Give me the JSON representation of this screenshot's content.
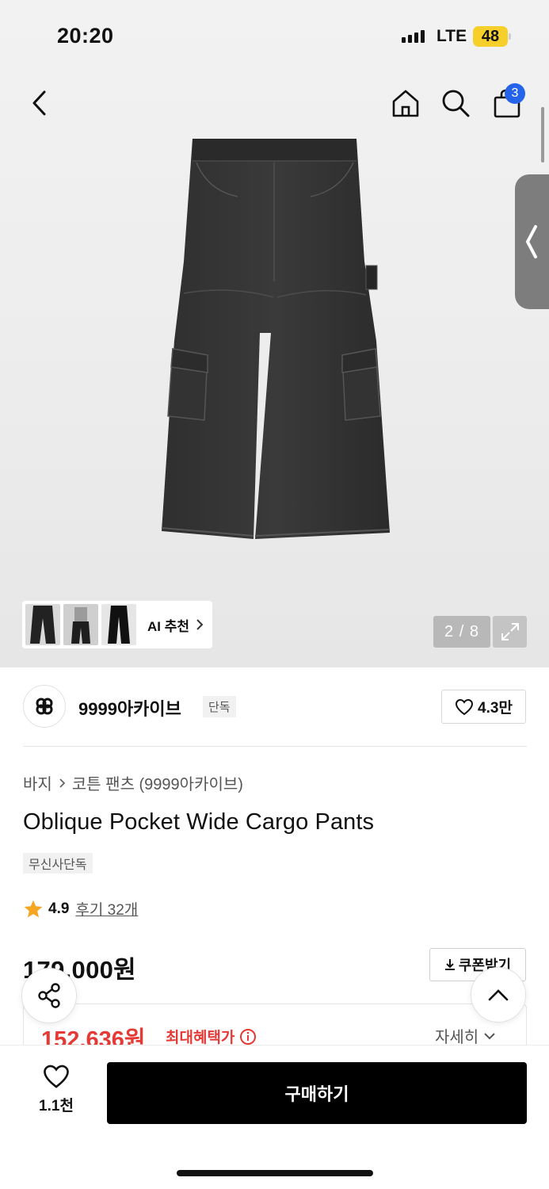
{
  "status": {
    "time": "20:20",
    "network": "LTE",
    "battery": "48"
  },
  "nav": {
    "cart_count": "3"
  },
  "gallery": {
    "ai_label": "AI 추천",
    "counter": "2 / 8"
  },
  "brand": {
    "name": "9999아카이브",
    "tag": "단독",
    "likes": "4.3만"
  },
  "breadcrumb": {
    "category": "바지",
    "subcategory": "코튼 팬츠 (9999아카이브)"
  },
  "product": {
    "title": "Oblique Pocket Wide Cargo Pants",
    "exclusive_tag": "무신사단독",
    "rating": "4.9",
    "reviews": "후기 32개",
    "price": "179,000원",
    "coupon_label": "쿠폰받기",
    "benefit_price": "152,636원",
    "benefit_label": "최대혜택가",
    "benefit_more": "자세히"
  },
  "bottom": {
    "wish_count": "1.1천",
    "buy_label": "구매하기"
  },
  "colors": {
    "accent_red": "#e53935",
    "badge_blue": "#2563eb",
    "star": "#f5a623",
    "battery": "#f6cf2a"
  }
}
